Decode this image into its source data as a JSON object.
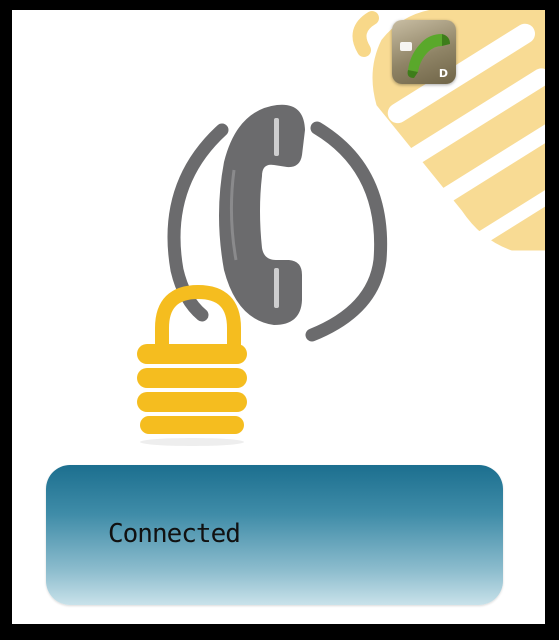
{
  "app_icon": {
    "name": "phone-app-icon",
    "badge_letter": "D"
  },
  "illustration": {
    "phone_icon": "phone-handset-icon",
    "lock_icon": "padlock-icon",
    "hand_icon": "hand-icon",
    "colors": {
      "phone": "#6b6b6d",
      "lock": "#f5bd1f",
      "hand": "#f8d889",
      "panel_top": "#1c6f8f",
      "panel_bottom": "#c9e2ea"
    }
  },
  "status": {
    "label": "Connected"
  }
}
